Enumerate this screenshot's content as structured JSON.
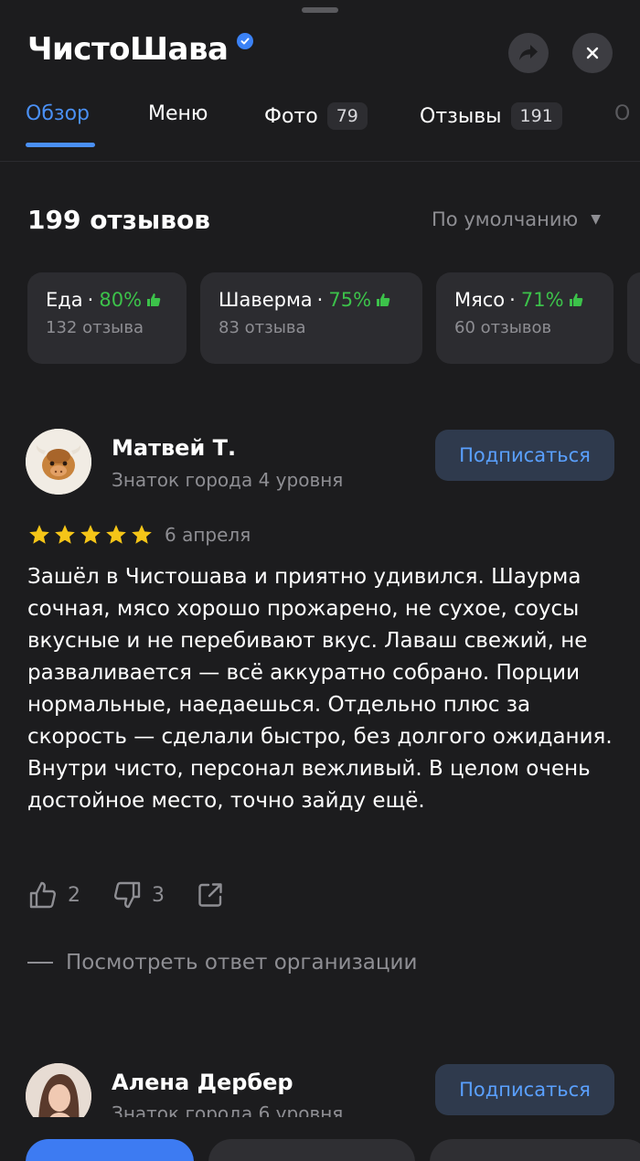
{
  "header": {
    "title": "ЧистоШава",
    "verified": true
  },
  "tabs": [
    {
      "label": "Обзор",
      "active": true
    },
    {
      "label": "Меню"
    },
    {
      "label": "Фото",
      "count": "79"
    },
    {
      "label": "Отзывы",
      "count": "191"
    },
    {
      "label": "О"
    }
  ],
  "reviews": {
    "total_label": "199 отзывов",
    "sort_label": "По умолчанию"
  },
  "aspects": [
    {
      "name": "Еда",
      "separator": "·",
      "percent": "80%",
      "count_label": "132 отзыва"
    },
    {
      "name": "Шаверма",
      "separator": "·",
      "percent": "75%",
      "count_label": "83 отзыва"
    },
    {
      "name": "Мясо",
      "separator": "·",
      "percent": "71%",
      "count_label": "60 отзывов"
    }
  ],
  "review1": {
    "author": "Матвей Т.",
    "level": "Знаток города 4 уровня",
    "subscribe_label": "Подписаться",
    "rating": 5,
    "date": "6 апреля",
    "text": "Зашёл в Чистошава и приятно удивился. Шаурма сочная, мясо хорошо прожарено, не сухое, соусы вкусные и не перебивают вкус. Лаваш свежий, не разваливается — всё аккуратно собрано. Порции нормальные, наедаешься. Отдельно плюс за скорость — сделали быстро, без долгого ожидания. Внутри чисто, персонал вежливый. В целом очень достойное место, точно зайду ещё.",
    "likes": "2",
    "dislikes": "3",
    "org_reply_label": "Посмотреть ответ организации"
  },
  "review2": {
    "author": "Алена Дербер",
    "level": "Знаток города 6 уровня",
    "subscribe_label": "Подписаться"
  },
  "colors": {
    "accent": "#4a90f5",
    "positive": "#3cc24a",
    "background": "#1c1c1e",
    "card": "#2c2c30"
  }
}
